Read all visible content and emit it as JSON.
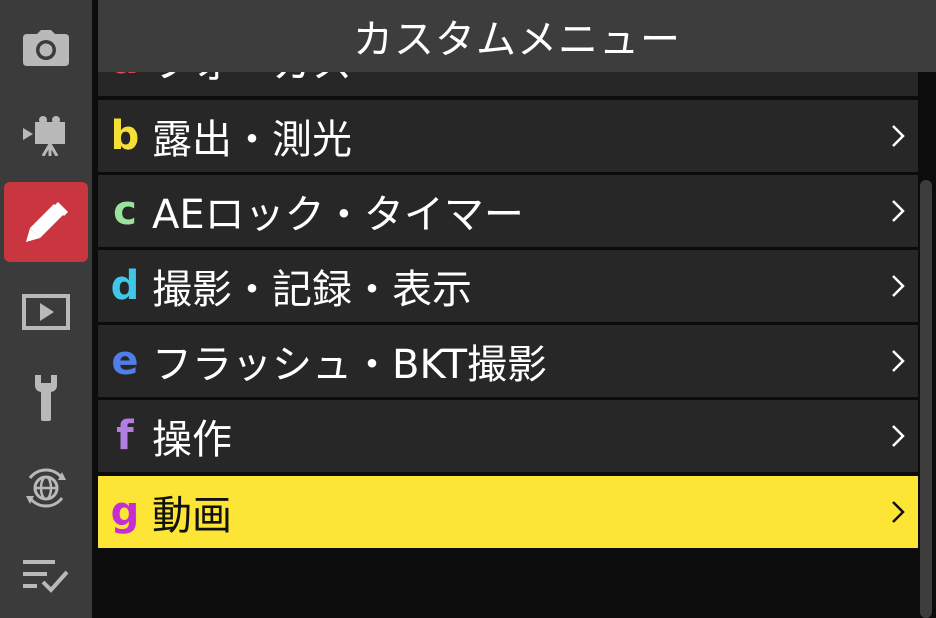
{
  "header": {
    "title": "カスタムメニュー"
  },
  "sidebar": {
    "tabs": [
      {
        "icon": "camera-icon",
        "active": false
      },
      {
        "icon": "video-camera-icon",
        "active": false
      },
      {
        "icon": "pencil-icon",
        "active": true
      },
      {
        "icon": "playback-icon",
        "active": false
      },
      {
        "icon": "wrench-icon",
        "active": false
      },
      {
        "icon": "network-globe-icon",
        "active": false
      },
      {
        "icon": "my-menu-check-icon",
        "active": false
      }
    ]
  },
  "menu": {
    "items": [
      {
        "letter": "a",
        "label": "フォーカス",
        "color": "#e84a5f"
      },
      {
        "letter": "b",
        "label": "露出・測光",
        "color": "#f5e03a"
      },
      {
        "letter": "c",
        "label": "AEロック・タイマー",
        "color": "#9be39a"
      },
      {
        "letter": "d",
        "label": "撮影・記録・表示",
        "color": "#3fc6e8"
      },
      {
        "letter": "e",
        "label": "フラッシュ・BKT撮影",
        "color": "#4f7ee8"
      },
      {
        "letter": "f",
        "label": "操作",
        "color": "#b27ee0"
      },
      {
        "letter": "g",
        "label": "動画",
        "color": "#c42fd4",
        "selected": true
      }
    ]
  },
  "colors": {
    "selected_bg": "#fce534",
    "active_tab": "#c9363f",
    "row_bg": "#272727"
  }
}
